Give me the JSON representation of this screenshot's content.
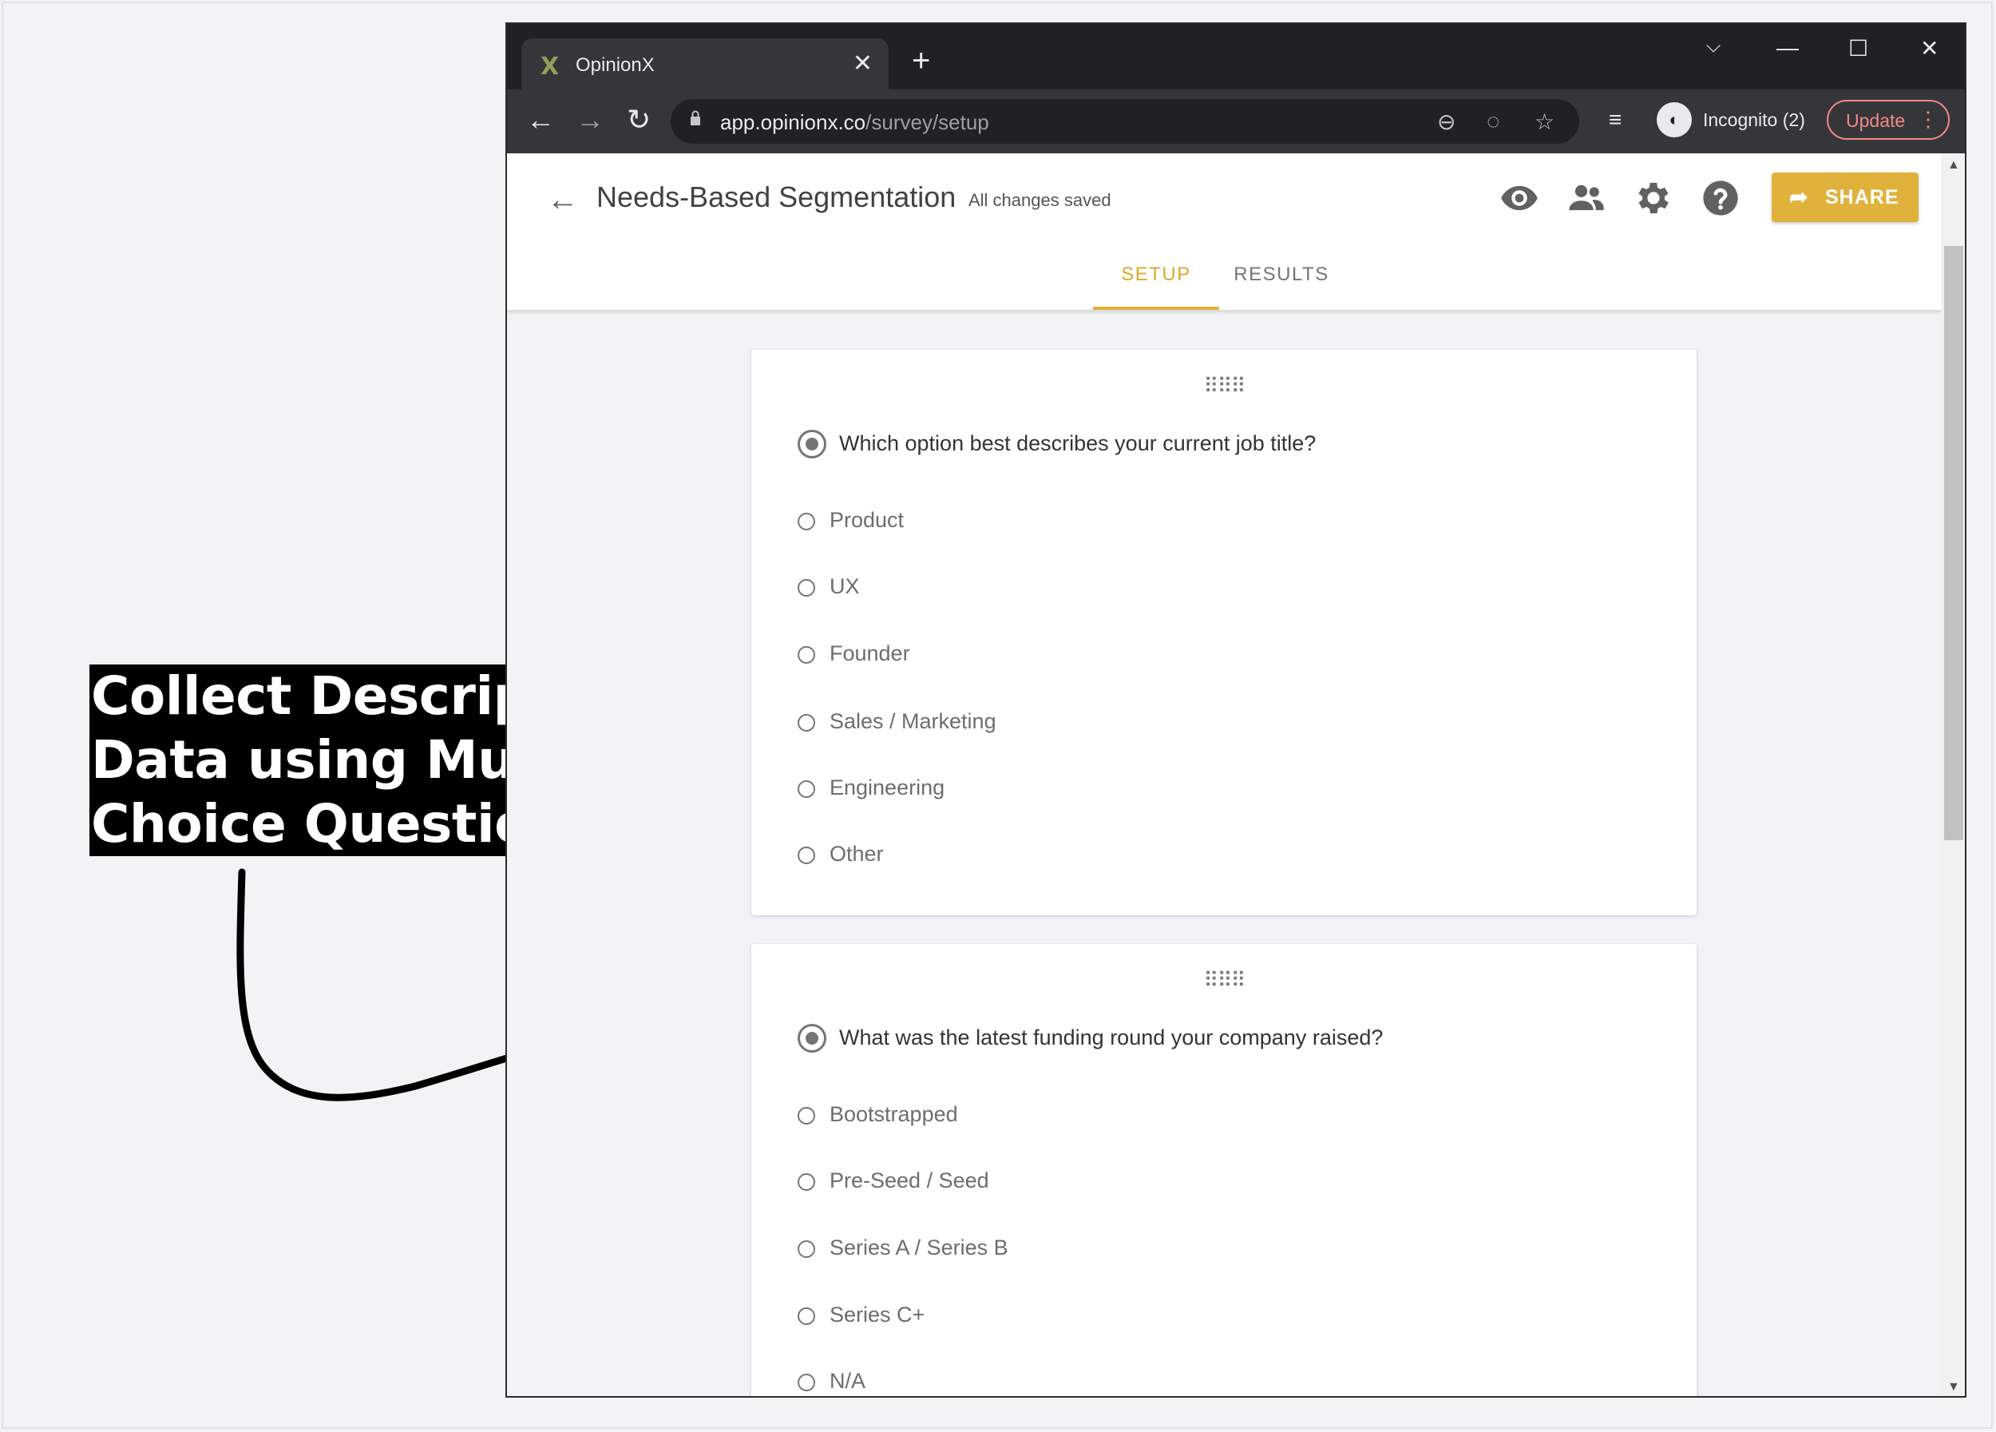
{
  "annotation": {
    "lines": [
      "Collect Descriptive",
      "Data using Multiple",
      "Choice Questions"
    ]
  },
  "browser": {
    "tab_title": "OpinionX",
    "url_host": "app.opinionx.co",
    "url_path": "/survey/setup",
    "incognito_label": "Incognito (2)",
    "update_label": "Update"
  },
  "app": {
    "survey_title": "Needs-Based Segmentation",
    "save_status": "All changes saved",
    "share_label": "SHARE",
    "accent_color": "#e0b23b",
    "tabs": [
      {
        "label": "SETUP",
        "active": true
      },
      {
        "label": "RESULTS",
        "active": false
      }
    ]
  },
  "questions": [
    {
      "text": "Which option best describes your current job title?",
      "options": [
        "Product",
        "UX",
        "Founder",
        "Sales / Marketing",
        "Engineering",
        "Other"
      ]
    },
    {
      "text": "What was the latest funding round your company raised?",
      "options": [
        "Bootstrapped",
        "Pre-Seed / Seed",
        "Series A / Series B",
        "Series C+",
        "N/A"
      ]
    }
  ]
}
